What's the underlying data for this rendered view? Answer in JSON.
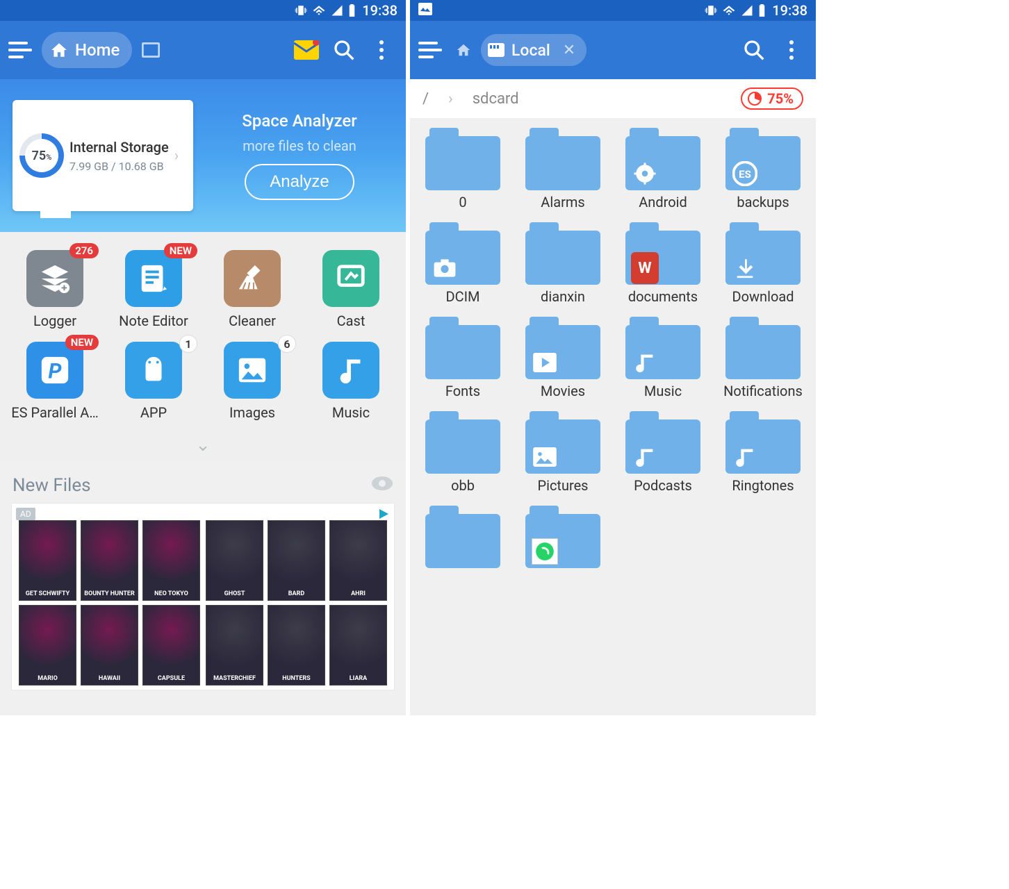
{
  "status": {
    "time": "19:38"
  },
  "phone1": {
    "toolbar": {
      "home_label": "Home"
    },
    "hero": {
      "storage": {
        "percent_label": "75",
        "percent_unit": "%",
        "title": "Internal Storage",
        "usage": "7.99 GB / 10.68 GB"
      },
      "analyzer": {
        "title": "Space Analyzer",
        "subtitle": "more files to clean",
        "button": "Analyze"
      }
    },
    "tools": [
      {
        "id": "logger",
        "label": "Logger",
        "color": "#7f8790",
        "badge": "276",
        "badge_type": "red",
        "icon": "stack"
      },
      {
        "id": "note",
        "label": "Note Editor",
        "color": "#2e9fe6",
        "badge": "NEW",
        "badge_type": "red",
        "icon": "note"
      },
      {
        "id": "cleaner",
        "label": "Cleaner",
        "color": "#b78a69",
        "badge": null,
        "badge_type": null,
        "icon": "broom"
      },
      {
        "id": "cast",
        "label": "Cast",
        "color": "#36b898",
        "badge": null,
        "badge_type": null,
        "icon": "cast"
      },
      {
        "id": "parallel",
        "label": "ES Parallel A…",
        "color": "#2f90e8",
        "badge": "NEW",
        "badge_type": "red",
        "icon": "parallel"
      },
      {
        "id": "app",
        "label": "APP",
        "color": "#33a0e8",
        "badge": "1",
        "badge_type": "white",
        "icon": "android"
      },
      {
        "id": "images",
        "label": "Images",
        "color": "#33a0e8",
        "badge": "6",
        "badge_type": "white",
        "icon": "image"
      },
      {
        "id": "music",
        "label": "Music",
        "color": "#33a0e8",
        "badge": null,
        "badge_type": null,
        "icon": "music"
      }
    ],
    "new_files": {
      "title": "New Files",
      "ad_tag": "AD"
    },
    "ad_posters_left": [
      "GET SCHWIFTY",
      "BOUNTY HUNTER",
      "NEO TOKYO",
      "MARIO",
      "HAWAII",
      "CAPSULE"
    ],
    "ad_posters_right": [
      "GHOST",
      "BARD",
      "AHRI",
      "MASTERCHIEF",
      "HUNTERS",
      "LIARA"
    ]
  },
  "phone2": {
    "toolbar": {
      "local_label": "Local"
    },
    "breadcrumb": {
      "root": "/",
      "current": "sdcard"
    },
    "usage_percent": "75%",
    "folders": [
      {
        "id": "0",
        "label": "0",
        "overlay": null
      },
      {
        "id": "alarms",
        "label": "Alarms",
        "overlay": null
      },
      {
        "id": "android",
        "label": "Android",
        "overlay": "gear"
      },
      {
        "id": "backups",
        "label": "backups",
        "overlay": "es"
      },
      {
        "id": "dcim",
        "label": "DCIM",
        "overlay": "camera"
      },
      {
        "id": "dianxin",
        "label": "dianxin",
        "overlay": null
      },
      {
        "id": "documents",
        "label": "documents",
        "overlay": "wps"
      },
      {
        "id": "download",
        "label": "Download",
        "overlay": "download"
      },
      {
        "id": "fonts",
        "label": "Fonts",
        "overlay": null
      },
      {
        "id": "movies",
        "label": "Movies",
        "overlay": "play"
      },
      {
        "id": "music",
        "label": "Music",
        "overlay": "music"
      },
      {
        "id": "notifications",
        "label": "Notifica­tions",
        "overlay": null
      },
      {
        "id": "obb",
        "label": "obb",
        "overlay": null
      },
      {
        "id": "pictures",
        "label": "Pictures",
        "overlay": "picture"
      },
      {
        "id": "podcasts",
        "label": "Podcasts",
        "overlay": "music"
      },
      {
        "id": "ringtones",
        "label": "Ringtones",
        "overlay": "music"
      },
      {
        "id": "extra1",
        "label": "",
        "overlay": null
      },
      {
        "id": "extra2",
        "label": "",
        "overlay": "whatsapp"
      }
    ]
  }
}
